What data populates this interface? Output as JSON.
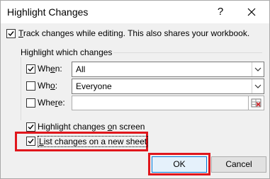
{
  "window": {
    "title": "Highlight Changes",
    "help_icon": "question-mark-icon",
    "close_icon": "close-icon"
  },
  "track": {
    "checked": true,
    "label_pre": "",
    "label_u": "T",
    "label_post": "rack changes while editing. This also shares your workbook."
  },
  "group": {
    "title": "Highlight which changes",
    "when": {
      "checked": true,
      "label_pre": "Wh",
      "label_u": "e",
      "label_post": "n:",
      "value": "All"
    },
    "who": {
      "checked": false,
      "label_pre": "Wh",
      "label_u": "o",
      "label_post": ":",
      "value": "Everyone"
    },
    "where": {
      "checked": false,
      "label_pre": "Whe",
      "label_u": "r",
      "label_post": "e:",
      "value": ""
    }
  },
  "highlight_screen": {
    "checked": true,
    "label_pre": "Highlight changes ",
    "label_u": "o",
    "label_post": "n screen"
  },
  "list_new_sheet": {
    "checked": true,
    "label_pre": "",
    "label_u": "L",
    "label_post": "ist changes on a new sheet"
  },
  "buttons": {
    "ok": "OK",
    "cancel": "Cancel"
  },
  "colors": {
    "highlight": "#e0161c",
    "accent": "#0078d7"
  }
}
